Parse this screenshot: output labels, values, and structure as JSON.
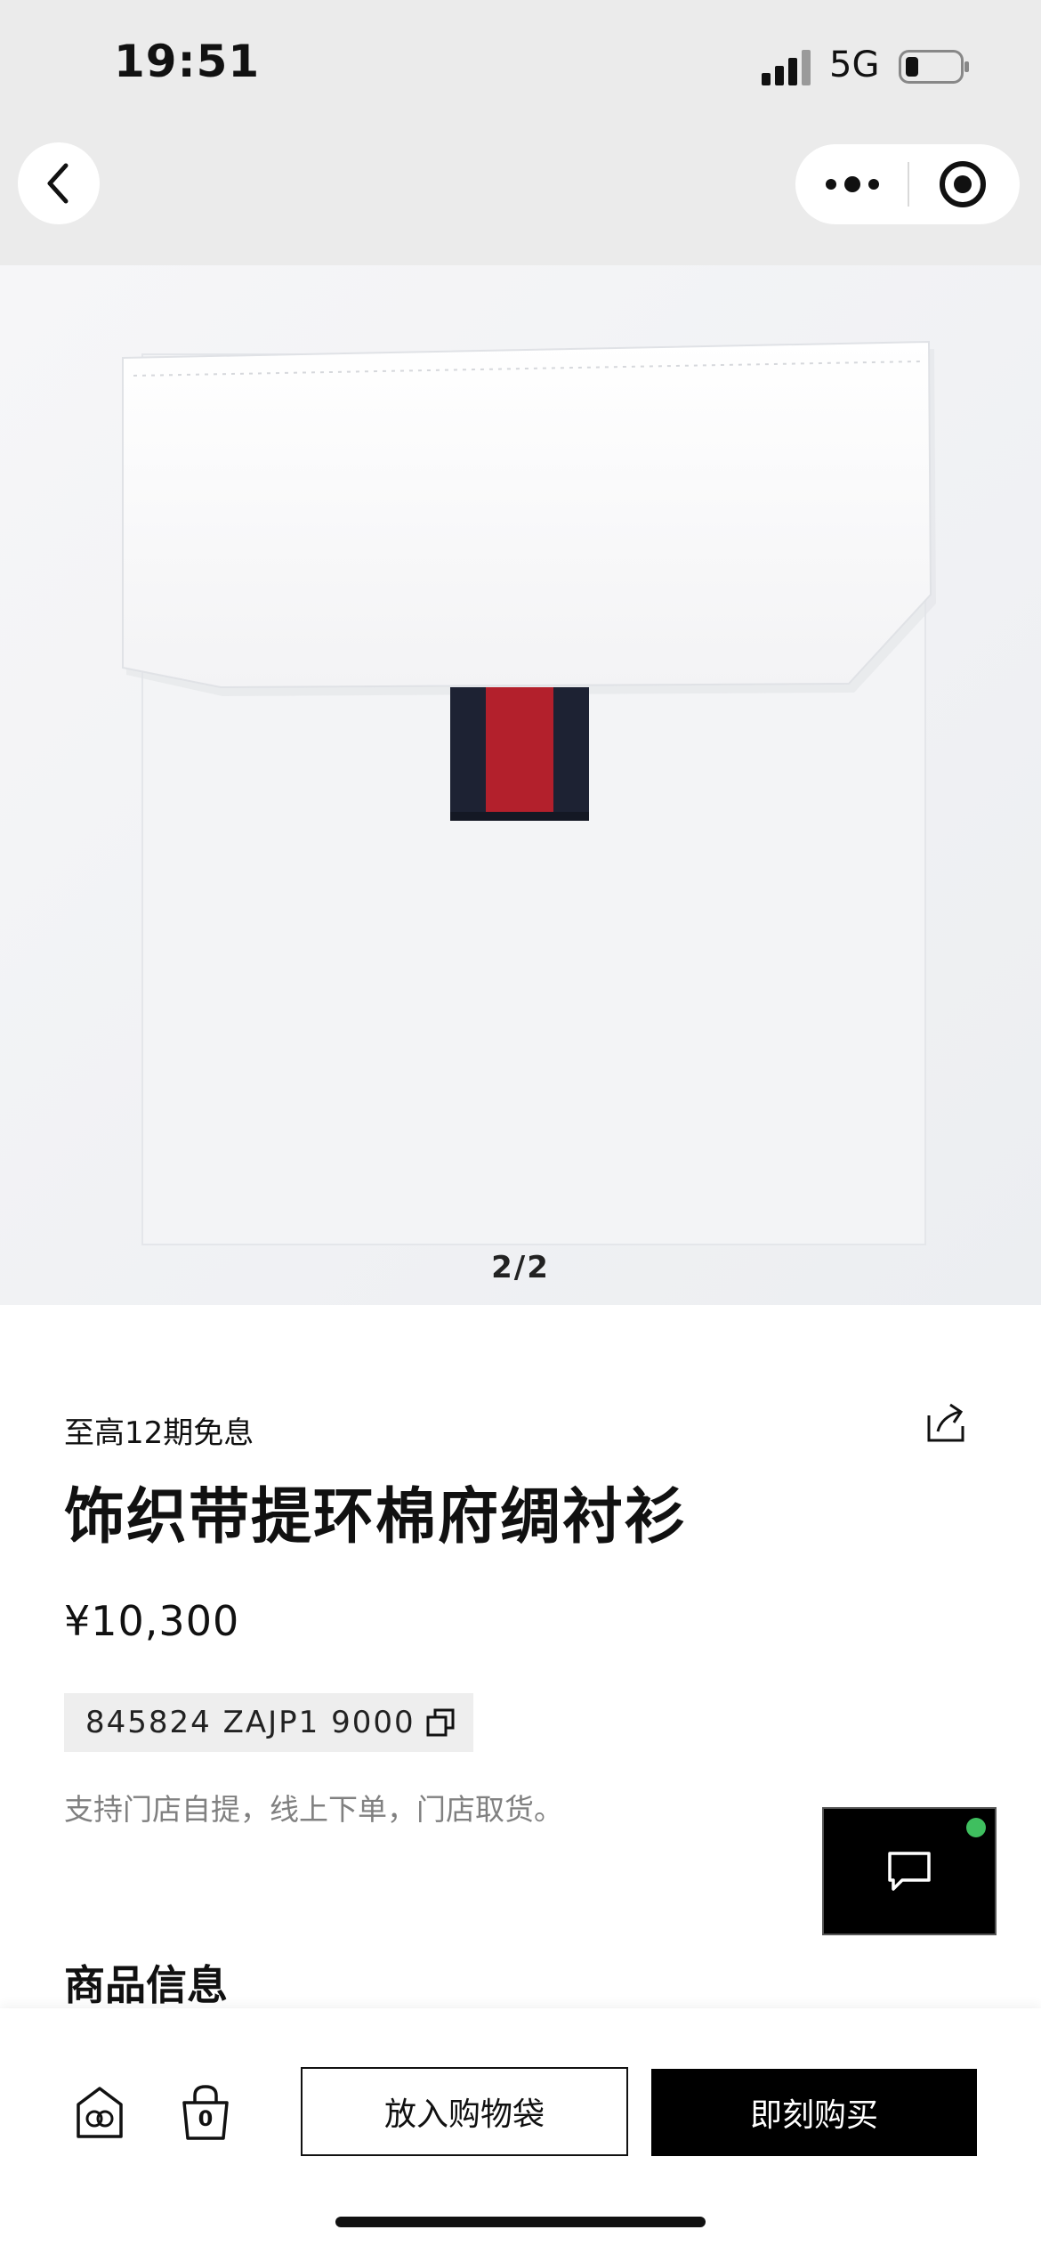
{
  "status_bar": {
    "time": "19:51",
    "network": "5G"
  },
  "product": {
    "image_counter": "2/2",
    "installment": "至高12期免息",
    "title": "饰织带提环棉府绸衬衫",
    "price": "¥10,300",
    "sku": "845824 ZAJP1 9000",
    "pickup_note": "支持门店自提，线上下单，门店取货。",
    "section_title": "商品信息"
  },
  "bottom_bar": {
    "bag_count": "0",
    "add_to_bag_label": "放入购物袋",
    "buy_now_label": "即刻购买"
  },
  "colors": {
    "accent": "#000000",
    "chat_status": "#3fbf5f",
    "ribbon_red": "#b3202c",
    "ribbon_navy": "#1d2233"
  },
  "icons": [
    "signal-icon",
    "battery-icon",
    "back-icon",
    "more-icon",
    "target-icon",
    "share-icon",
    "copy-icon",
    "chat-icon",
    "gucci-logo-icon",
    "shopping-bag-icon"
  ]
}
